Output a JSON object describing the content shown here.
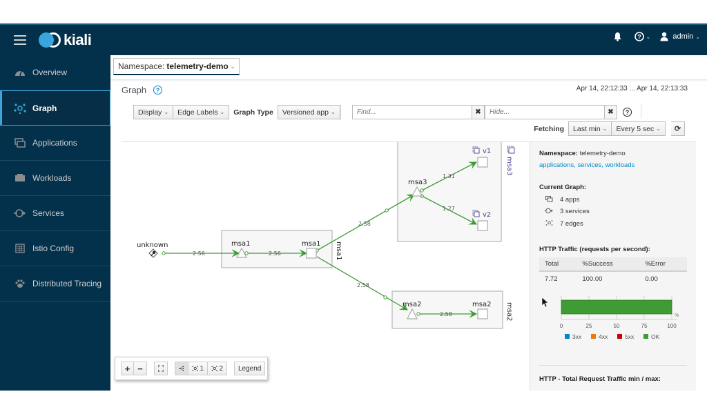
{
  "masthead": {
    "brand": "kiali",
    "user": "admin",
    "icons": [
      "hamburger-icon",
      "bell-icon",
      "help-icon",
      "user-icon"
    ]
  },
  "sidebar": {
    "items": [
      {
        "label": "Overview",
        "icon": "overview-icon",
        "active": false
      },
      {
        "label": "Graph",
        "icon": "graph-icon",
        "active": true
      },
      {
        "label": "Applications",
        "icon": "applications-icon",
        "active": false
      },
      {
        "label": "Workloads",
        "icon": "workloads-icon",
        "active": false
      },
      {
        "label": "Services",
        "icon": "services-icon",
        "active": false
      },
      {
        "label": "Istio Config",
        "icon": "istio-config-icon",
        "active": false
      },
      {
        "label": "Distributed Tracing",
        "icon": "paw-icon",
        "active": false
      }
    ]
  },
  "namespace": {
    "label": "Namespace:",
    "value": "telemetry-demo"
  },
  "page": {
    "title": "Graph",
    "time_range": "Apr 14, 22:12:33 ... Apr 14, 22:13:33"
  },
  "toolbar": {
    "display": "Display",
    "edge_labels": "Edge Labels",
    "graph_type_label": "Graph Type",
    "graph_type": "Versioned app",
    "find_placeholder": "Find...",
    "hide_placeholder": "Hide...",
    "fetching_label": "Fetching",
    "duration": "Last min",
    "refresh_interval": "Every 5 sec"
  },
  "graph": {
    "boxes": [
      {
        "id": "box-msa1",
        "label": "msa1"
      },
      {
        "id": "box-msa3",
        "label": "msa3"
      },
      {
        "id": "box-msa2",
        "label": "msa2"
      }
    ],
    "nodes": [
      {
        "id": "unknown",
        "label": "unknown",
        "type": "unknown"
      },
      {
        "id": "msa1-svc",
        "label": "msa1",
        "type": "service"
      },
      {
        "id": "msa1-app",
        "label": "msa1",
        "type": "app"
      },
      {
        "id": "msa3-svc",
        "label": "msa3",
        "type": "service"
      },
      {
        "id": "msa3-v1",
        "label": "v1",
        "type": "version"
      },
      {
        "id": "msa3-v2",
        "label": "v2",
        "type": "version"
      },
      {
        "id": "msa2-svc",
        "label": "msa2",
        "type": "service"
      },
      {
        "id": "msa2-app",
        "label": "msa2",
        "type": "app"
      }
    ],
    "edges": [
      {
        "from": "unknown",
        "to": "msa1-svc",
        "label": "2.56"
      },
      {
        "from": "msa1-svc",
        "to": "msa1-app",
        "label": "2.56"
      },
      {
        "from": "msa1-app",
        "to": "msa3-svc",
        "label": "2.58"
      },
      {
        "from": "msa1-app",
        "to": "msa2-svc",
        "label": "2.58"
      },
      {
        "from": "msa3-svc",
        "to": "msa3-v1",
        "label": "1.31"
      },
      {
        "from": "msa3-svc",
        "to": "msa3-v2",
        "label": "1.27"
      },
      {
        "from": "msa2-svc",
        "to": "msa2-app",
        "label": "2.58"
      }
    ]
  },
  "graph_toolbar": {
    "zoom_in": "+",
    "zoom_out": "−",
    "layout1": "1",
    "layout2": "2",
    "legend": "Legend"
  },
  "side_panel": {
    "namespace_label": "Namespace:",
    "namespace_value": "telemetry-demo",
    "links": "applications, services, workloads",
    "current_graph_label": "Current Graph:",
    "apps": "4 apps",
    "services": "3 services",
    "edges": "7 edges",
    "http_traffic_label": "HTTP Traffic (requests per second):",
    "table": {
      "headers": [
        "Total",
        "%Success",
        "%Error"
      ],
      "row": [
        "7.72",
        "100.00",
        "0.00"
      ]
    },
    "total_traffic_label": "HTTP - Total Request Traffic min / max:"
  },
  "chart_data": {
    "type": "bar",
    "orientation": "horizontal",
    "stacked": true,
    "categories": [
      ""
    ],
    "series": [
      {
        "name": "3xx",
        "color": "#0088ce",
        "values": [
          0
        ]
      },
      {
        "name": "4xx",
        "color": "#ec7a08",
        "values": [
          0
        ]
      },
      {
        "name": "5xx",
        "color": "#cc0000",
        "values": [
          0
        ]
      },
      {
        "name": "OK",
        "color": "#3f9c35",
        "values": [
          100
        ]
      }
    ],
    "xlim": [
      0,
      100
    ],
    "xticks": [
      0,
      25,
      50,
      75,
      100
    ],
    "xlabel": "%",
    "legend": "bottom"
  }
}
